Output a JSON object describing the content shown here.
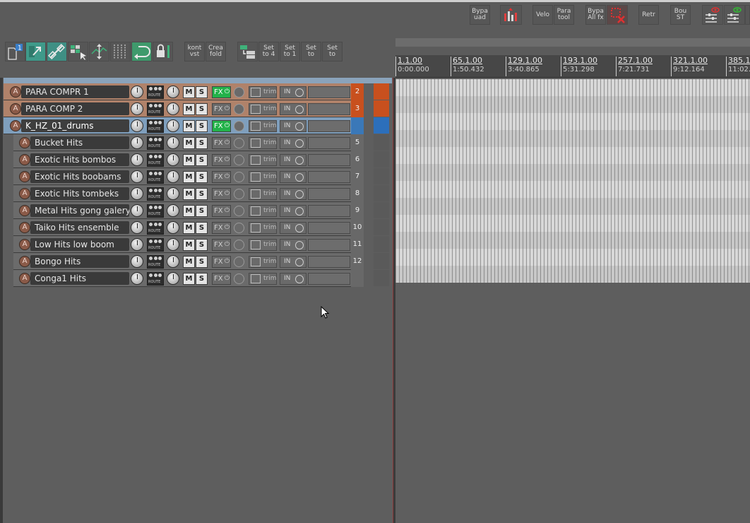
{
  "toolbar_left": {
    "kont_vst": [
      "kont",
      "vst"
    ],
    "crea_fold": [
      "Crea",
      "fold"
    ],
    "set_buttons": [
      [
        "Set",
        "to 4"
      ],
      [
        "Set",
        "to 1"
      ],
      [
        "Set",
        "to"
      ],
      [
        "Set",
        "to"
      ]
    ]
  },
  "toolbar_top": {
    "bypa_uad": [
      "Bypa",
      "uad"
    ],
    "velo": "Velo",
    "para_tool": [
      "Para",
      "tool"
    ],
    "bypa_all_fx": [
      "Bypa",
      "All fx"
    ],
    "retr": "Retr",
    "bou_st": [
      "Bou",
      "ST"
    ]
  },
  "tracks": [
    {
      "name": "PARA COMPR 1",
      "num": "2",
      "arm": "A",
      "fx_on": true,
      "color": "#b0826a"
    },
    {
      "name": "PARA COMP 2",
      "num": "3",
      "arm": "A",
      "fx_on": false,
      "color": "#b0826a"
    },
    {
      "name": "K_HZ_01_drums",
      "num": "",
      "arm": "A",
      "fx_on": true,
      "color": "#4d7aa8"
    },
    {
      "name": "Bucket Hits",
      "num": "5",
      "arm": "A",
      "fx_on": false
    },
    {
      "name": "Exotic Hits bombos",
      "num": "6",
      "arm": "A",
      "fx_on": false
    },
    {
      "name": "Exotic Hits boobams",
      "num": "7",
      "arm": "A",
      "fx_on": false
    },
    {
      "name": "Exotic Hits tombeks",
      "num": "8",
      "arm": "A",
      "fx_on": false
    },
    {
      "name": "Metal Hits gong galery",
      "num": "9",
      "arm": "A",
      "fx_on": false
    },
    {
      "name": "Taiko Hits ensemble",
      "num": "10",
      "arm": "A",
      "fx_on": false
    },
    {
      "name": "Low Hits low boom",
      "num": "11",
      "arm": "A",
      "fx_on": false
    },
    {
      "name": "Bongo Hits",
      "num": "12",
      "arm": "A",
      "fx_on": false
    },
    {
      "name": "Conga1 Hits",
      "num": "",
      "arm": "A",
      "fx_on": false
    }
  ],
  "track_labels": {
    "mute": "M",
    "solo": "S",
    "fx": "FX",
    "trim": "trim",
    "input": "IN",
    "route": "ROUTE"
  },
  "ruler": [
    {
      "bar": "1.1.00",
      "time": "0:00.000"
    },
    {
      "bar": "65.1.00",
      "time": "1:50.432"
    },
    {
      "bar": "129.1.00",
      "time": "3:40.865"
    },
    {
      "bar": "193.1.00",
      "time": "5:31.298"
    },
    {
      "bar": "257.1.00",
      "time": "7:21.731"
    },
    {
      "bar": "321.1.00",
      "time": "9:12.164"
    },
    {
      "bar": "385.1",
      "time": "11:02."
    }
  ],
  "colors": {
    "accent_orange": "#c8501e",
    "fx_green": "#23b24a",
    "selected_blue": "#4a6d8e"
  }
}
